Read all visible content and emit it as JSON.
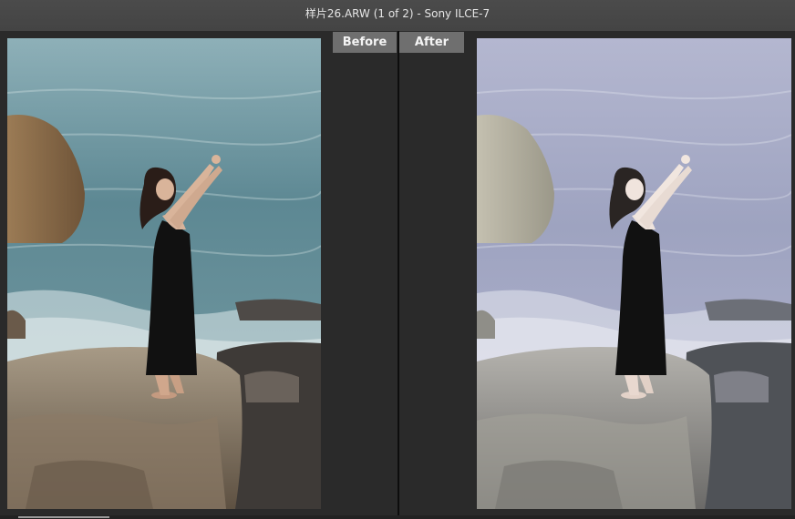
{
  "window": {
    "title": "样片26.ARW (1 of 2)  -  Sony ILCE-7"
  },
  "compare": {
    "before_label": "Before",
    "after_label": "After"
  },
  "colors": {
    "before_sea": "#5f8a97",
    "after_sea": "#a3a7c4",
    "tab_bg": "#6f6f6f",
    "background": "#2b2b2b"
  }
}
